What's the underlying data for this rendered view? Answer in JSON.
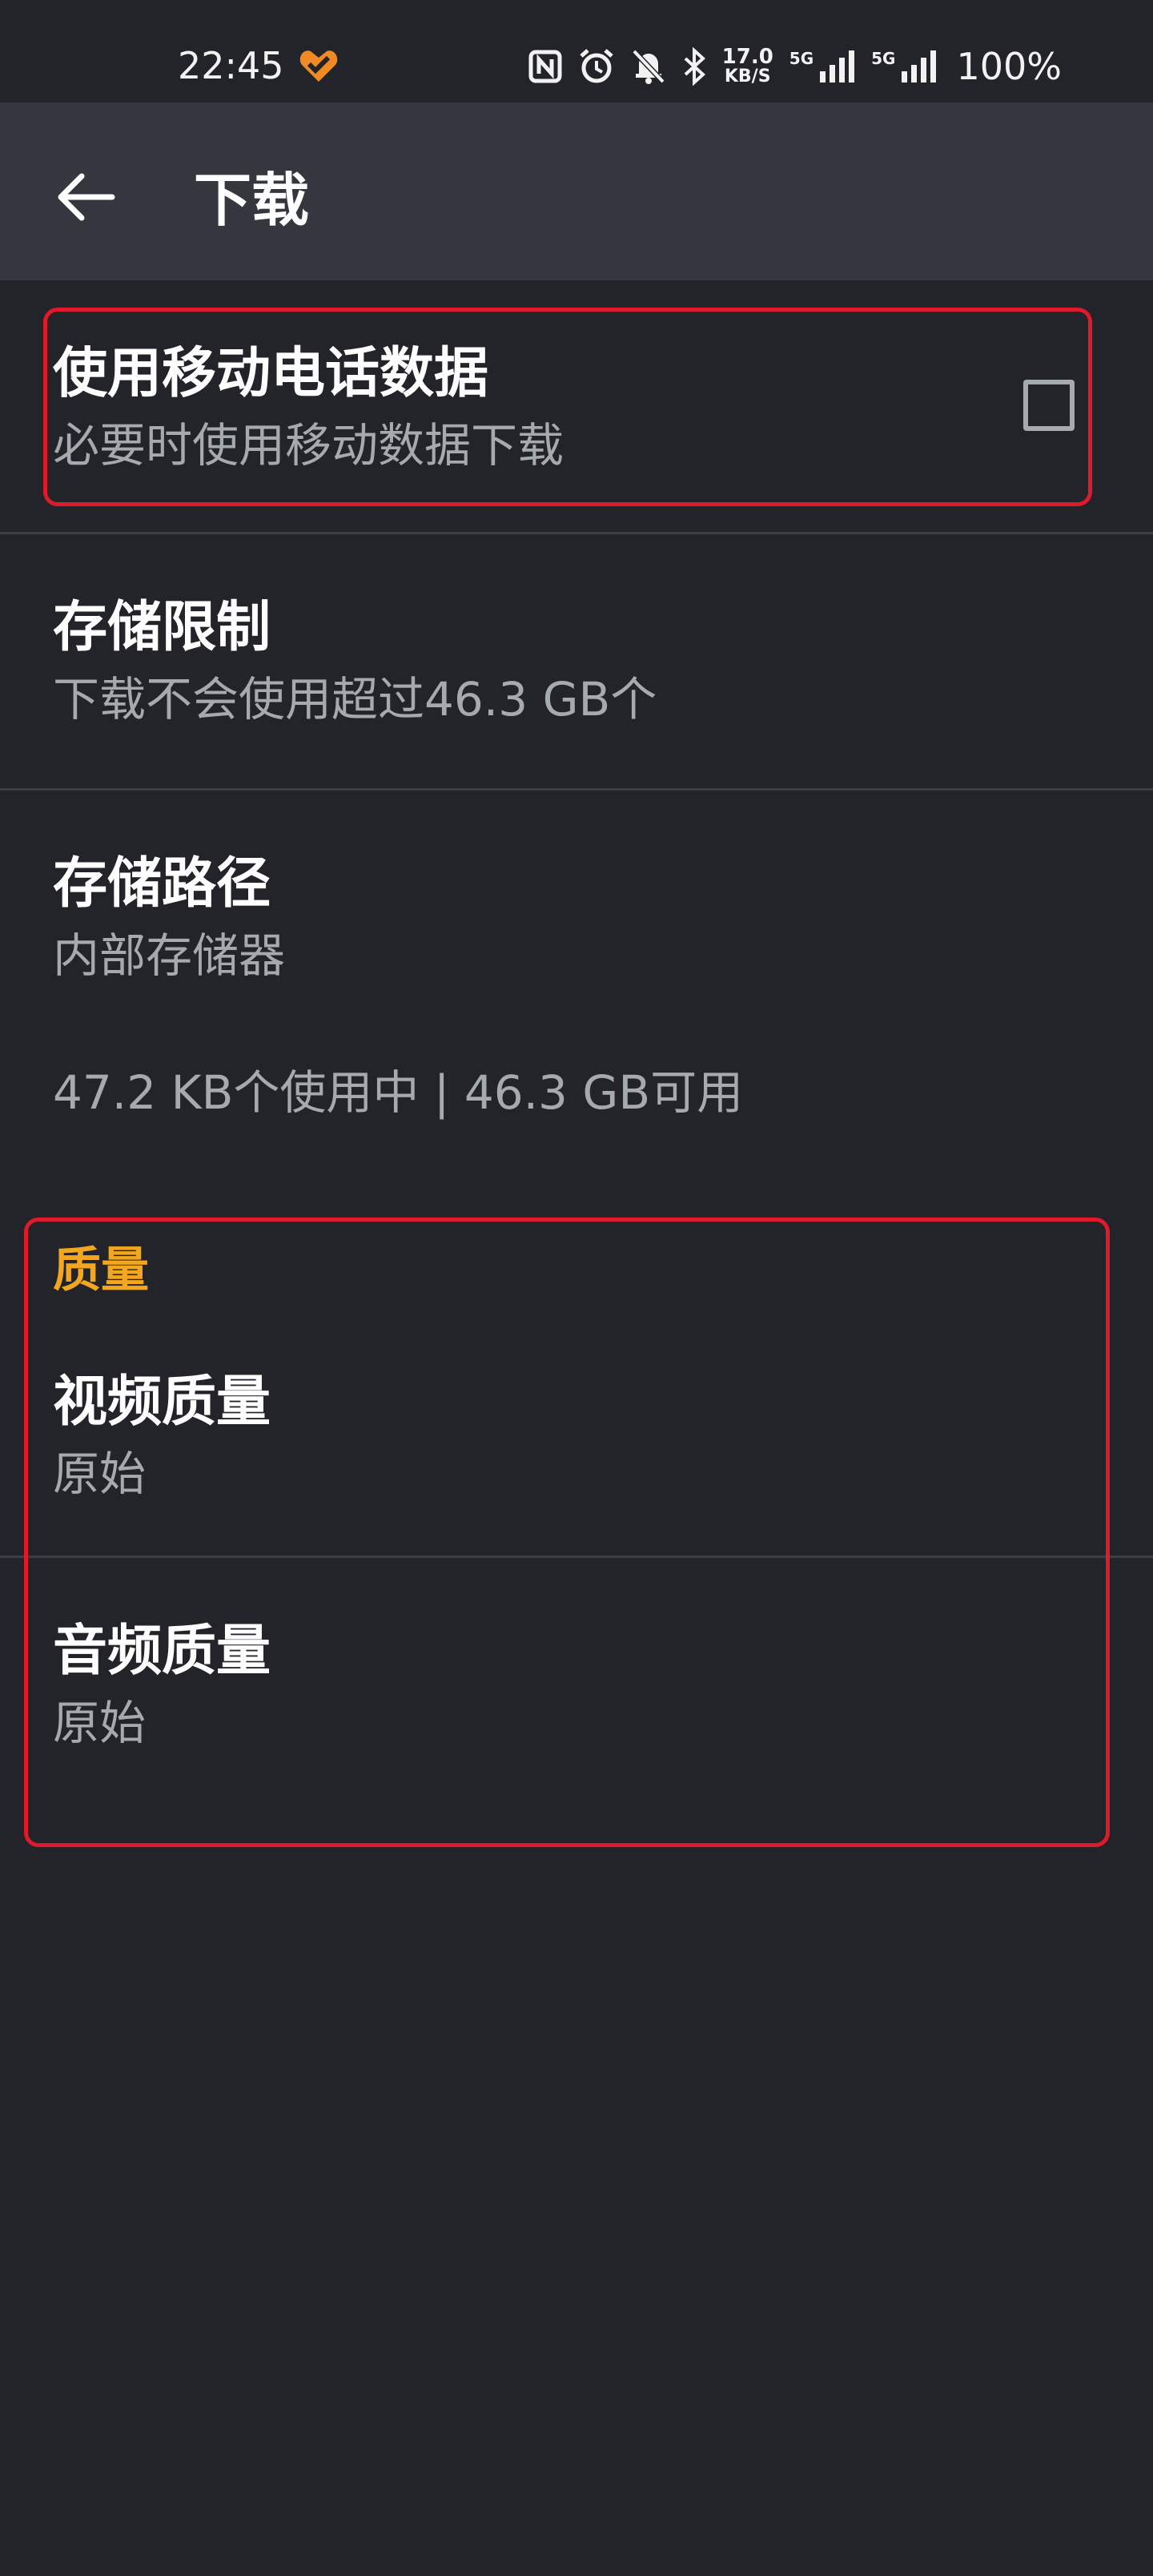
{
  "status_bar": {
    "time": "22:45",
    "net_speed_value": "17.0",
    "net_speed_unit": "KB/S",
    "sim1_network": "5G",
    "sim2_network": "5G",
    "battery": "100%",
    "icons": [
      "heart-app-icon",
      "nfc-icon",
      "alarm-icon",
      "bell-off-icon",
      "bluetooth-icon",
      "signal-icon",
      "signal-icon"
    ]
  },
  "app_bar": {
    "title": "下载",
    "back_icon": "arrow-back-icon"
  },
  "settings": {
    "mobile_data": {
      "title": "使用移动电话数据",
      "subtitle": "必要时使用移动数据下载",
      "checked": false
    },
    "storage_limit": {
      "title": "存储限制",
      "subtitle": "下载不会使用超过46.3 GB个"
    },
    "storage_path": {
      "title": "存储路径",
      "subtitle": "内部存储器"
    },
    "storage_info": "47.2 KB个使用中 | 46.3 GB可用"
  },
  "quality": {
    "header": "质量",
    "video": {
      "title": "视频质量",
      "subtitle": "原始"
    },
    "audio": {
      "title": "音频质量",
      "subtitle": "原始"
    }
  },
  "colors": {
    "background": "#222429",
    "app_bar": "#34373d",
    "accent": "#f2a71e",
    "highlight_box": "#e0192b",
    "secondary_text": "#a5a9b0"
  }
}
